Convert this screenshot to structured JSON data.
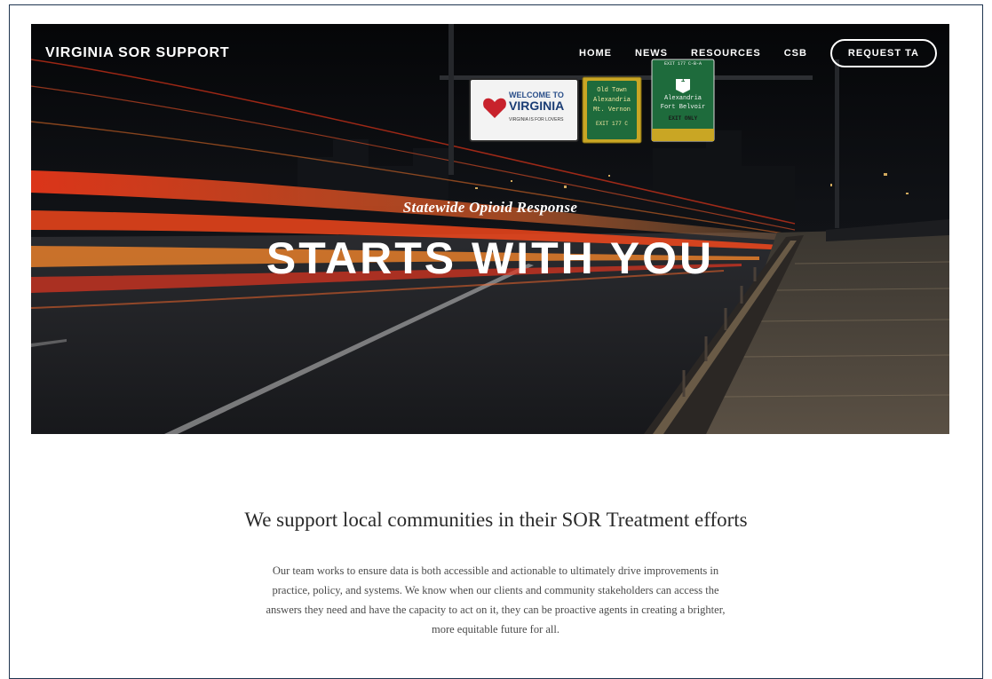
{
  "site": {
    "brand": "VIRGINIA SOR SUPPORT"
  },
  "nav": {
    "items": [
      {
        "label": "HOME"
      },
      {
        "label": "NEWS"
      },
      {
        "label": "RESOURCES"
      },
      {
        "label": "CSB"
      }
    ],
    "cta_label": "REQUEST TA"
  },
  "hero": {
    "kicker": "Statewide Opioid Response",
    "title": "STARTS WITH YOU",
    "signs": {
      "welcome_line1": "WELCOME TO",
      "welcome_line2": "VIRGINIA",
      "welcome_tag": "VIRGINIA IS FOR LOVERS",
      "old_town_lines": [
        "Old Town",
        "Alexandria",
        "Mt. Vernon"
      ],
      "old_town_exit": "EXIT 177 C",
      "route_exit_top": "EXIT 177 C-B-A",
      "route_number": "1",
      "route_lines": [
        "Alexandria",
        "Fort Belvoir"
      ],
      "route_exit_only": "EXIT ONLY"
    }
  },
  "intro": {
    "heading": "We support local communities in their SOR Treatment efforts",
    "body": "Our team works to ensure data is both accessible and actionable to ultimately drive improvements in practice, policy, and systems. We know when our clients and community stakeholders can access the answers they need and have the capacity to act on it, they can be proactive agents in creating a brighter, more equitable future for all."
  },
  "colors": {
    "frame_border": "#1f3550",
    "hero_dark": "#0b0c10",
    "light_trail_red": "#e2341f",
    "light_trail_orange": "#f28a2e",
    "sign_green": "#1e6b3c",
    "sign_yellow": "#c9a624"
  }
}
